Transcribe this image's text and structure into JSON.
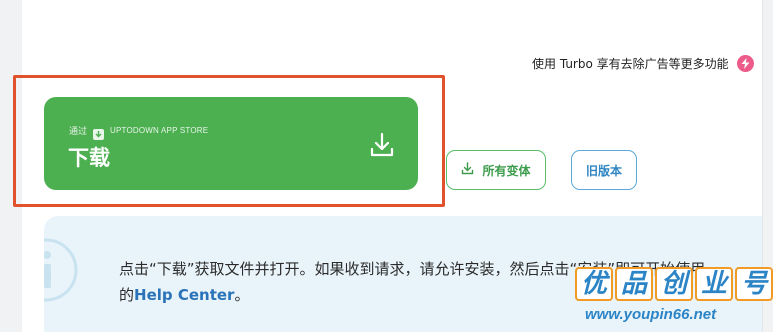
{
  "turbo_promo": {
    "text": "使用 Turbo 享有去除广告等更多功能",
    "icon": "lightning-icon",
    "color": "#ec5b8a"
  },
  "download_button": {
    "via_label": "通过",
    "store_label": "UPTODOWN APP STORE",
    "label": "下载",
    "icon": "download-icon",
    "color": "#4caf50"
  },
  "highlight_color": "#e0522c",
  "all_variants_button": {
    "label": "所有变体",
    "icon": "download-icon",
    "color": "#5bbd6a"
  },
  "old_versions_button": {
    "label": "旧版本",
    "color": "#5aa9d6"
  },
  "info_panel": {
    "line1": "点击“下载”获取文件并打开。如果收到请求，请允许安装，然后点击“安装”即可开始使用",
    "line2_prefix": "的",
    "help_link": "Help Center",
    "line2_suffix": "。",
    "icon": "info-icon"
  },
  "watermark": {
    "chars": [
      "优",
      "品",
      "创",
      "业",
      "号"
    ],
    "url": "www.youpin66.net"
  }
}
